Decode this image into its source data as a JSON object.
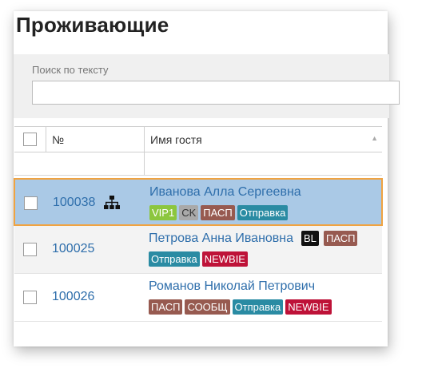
{
  "page": {
    "title": "Проживающие"
  },
  "search": {
    "label": "Поиск по тексту",
    "value": "",
    "placeholder": ""
  },
  "table": {
    "columns": {
      "number": "№",
      "guest_name": "Имя гостя"
    },
    "rows": [
      {
        "number": "100038",
        "guest": "Иванова Алла Сергеевна",
        "selected": true,
        "icon": "hierarchy-icon",
        "tags": [
          {
            "text": "VIP1",
            "color": "#8cc63e"
          },
          {
            "text": "CK",
            "color": "#a9a9a9",
            "text_color": "#333333"
          },
          {
            "text": "ПАСП",
            "color": "#975a50"
          },
          {
            "text": "Отправка",
            "color": "#2a8ba3"
          }
        ]
      },
      {
        "number": "100025",
        "guest": "Петрова Анна Ивановна",
        "inline_tags": [
          {
            "text": "BL",
            "color": "#111111"
          },
          {
            "text": "ПАСП",
            "color": "#975a50"
          }
        ],
        "tags": [
          {
            "text": "Отправка",
            "color": "#2a8ba3"
          },
          {
            "text": "NEWBIE",
            "color": "#be1238"
          }
        ]
      },
      {
        "number": "100026",
        "guest": "Романов Николай Петрович",
        "tags": [
          {
            "text": "ПАСП",
            "color": "#975a50"
          },
          {
            "text": "СООБЩ",
            "color": "#975a50"
          },
          {
            "text": "Отправка",
            "color": "#2a8ba3"
          },
          {
            "text": "NEWBIE",
            "color": "#be1238"
          }
        ]
      }
    ]
  },
  "colors": {
    "link": "#2e6eab",
    "selected_row": "#aac9e6",
    "selected_border": "#f0a341"
  }
}
